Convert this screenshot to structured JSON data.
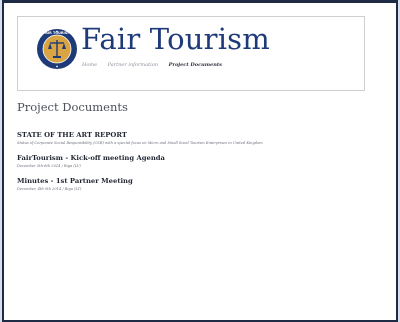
{
  "site": {
    "title": "Fair Tourism",
    "logo_ring_text": "FAIR TOURISM"
  },
  "nav": {
    "items": [
      "Home",
      "Partner information",
      "Project Documents"
    ],
    "active": "Project Documents"
  },
  "main": {
    "heading": "Project Documents",
    "documents": [
      {
        "title": "STATE OF THE ART REPORT",
        "meta": "Status of Corporate Social Responsibility (CSR) with a special focus on Micro and Small Sized Tourism Enterprises in United Kingdom"
      },
      {
        "title": "FairTourism - Kick-off meeting Agenda",
        "meta": "December 5th-6th 2014 / Riga (LV)"
      },
      {
        "title": "Minutes - 1st Partner Meeting",
        "meta": "December, 4th-5th 2014 / Riga (LT)"
      }
    ]
  },
  "colors": {
    "title_blue": "#1e3a78",
    "logo_outer": "#1e3a78",
    "logo_inner": "#d9a441",
    "frame": "#1f2a44",
    "background": "#d4e0ee"
  },
  "icons": {
    "logo": "fair-tourism-seal-icon"
  }
}
